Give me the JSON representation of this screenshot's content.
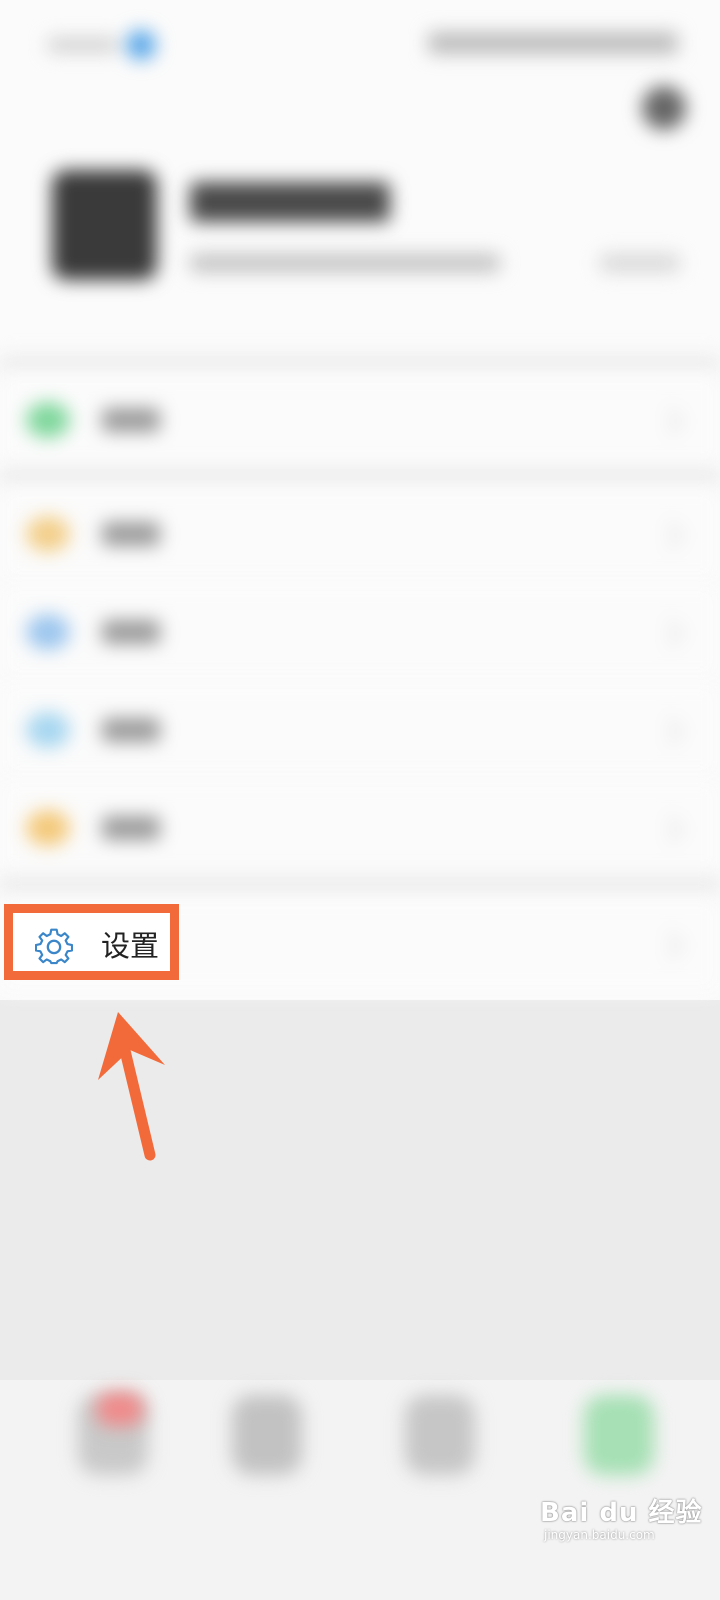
{
  "settings_label": "设置",
  "watermark": {
    "brand": "Bai du 经验",
    "site": "jingyan.baidu.com"
  },
  "colors": {
    "highlight": "#f26a3a",
    "gear_icon": "#3a86c8",
    "page_bg": "#ebebeb"
  },
  "icons": {
    "settings": "gear-icon",
    "annotation": "arrow-up-icon"
  }
}
